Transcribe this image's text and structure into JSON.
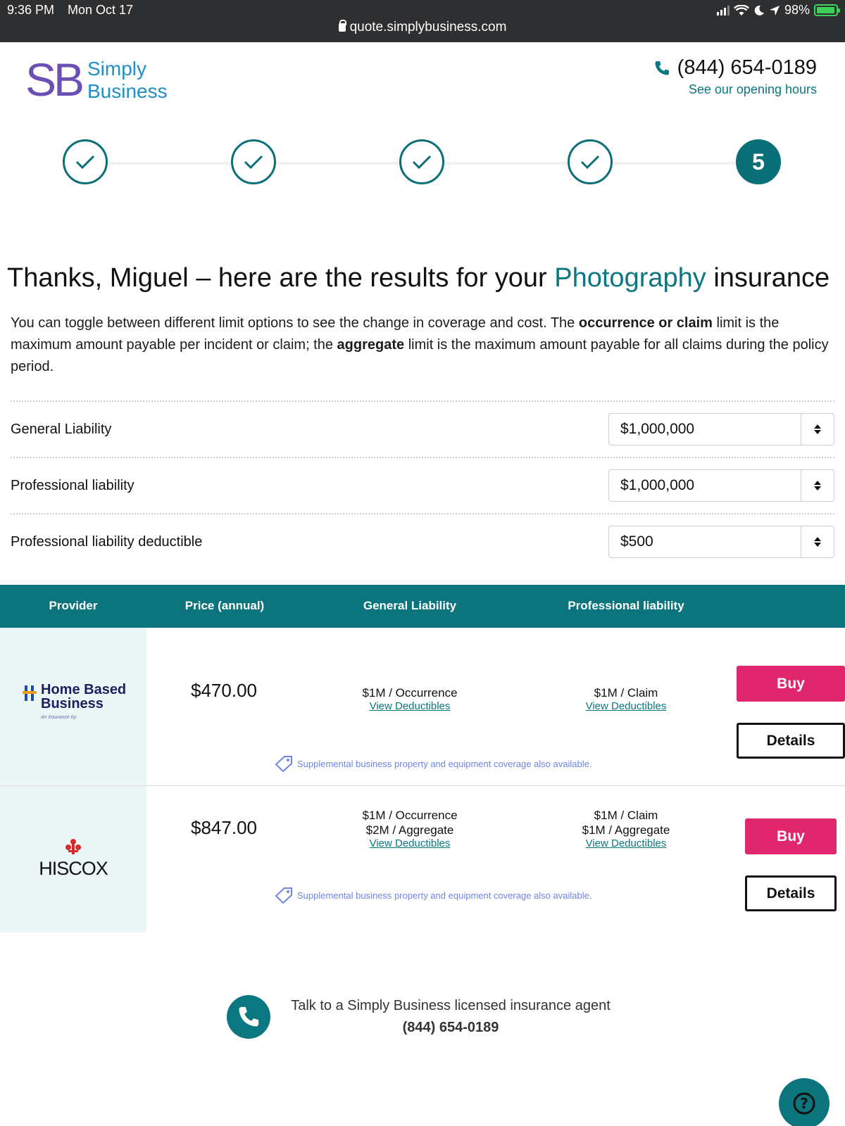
{
  "status_bar": {
    "time": "9:36 PM",
    "date": "Mon Oct 17",
    "battery": "98%",
    "battery_level": 0.98,
    "url": "quote.simplybusiness.com"
  },
  "header": {
    "logo_mark": "SB",
    "logo_line1": "Simply",
    "logo_line2": "Business",
    "phone": "(844) 654-0189",
    "opening_hours_link": "See our opening hours"
  },
  "progress": {
    "current_step": "5",
    "completed_steps": 4
  },
  "page": {
    "title_before": "Thanks, Miguel – here are the results for your ",
    "title_highlight": "Photography",
    "title_after": " insurance",
    "intro_1": "You can toggle between different limit options to see the change in coverage and cost. The ",
    "intro_bold_1": "occurrence or claim",
    "intro_2": " limit is the maximum amount payable per incident or claim; the ",
    "intro_bold_2": "aggregate",
    "intro_3": " limit is the maximum amount payable for all claims during the policy period."
  },
  "limits": [
    {
      "label": "General Liability",
      "value": "$1,000,000"
    },
    {
      "label": "Professional liability",
      "value": "$1,000,000"
    },
    {
      "label": "Professional liability deductible",
      "value": "$500"
    }
  ],
  "table": {
    "headers": [
      "Provider",
      "Price (annual)",
      "General Liability",
      "Professional liability"
    ],
    "rows": [
      {
        "provider_line1": "Home Based",
        "provider_line2": "Business",
        "provider_sub": "An insurance by",
        "price": "$470.00",
        "gl_line1": "$1M / Occurrence",
        "gl_line2": "",
        "gl_link": "View Deductibles",
        "pl_line1": "$1M / Claim",
        "pl_line2": "",
        "pl_link": "View Deductibles",
        "supplemental": "Supplemental business property and equipment coverage also available.",
        "buy": "Buy",
        "details": "Details"
      },
      {
        "provider_line1": "HISCOX",
        "price": "$847.00",
        "gl_line1": "$1M / Occurrence",
        "gl_line2": "$2M / Aggregate",
        "gl_link": "View Deductibles",
        "pl_line1": "$1M / Claim",
        "pl_line2": "$1M / Aggregate",
        "pl_link": "View Deductibles",
        "supplemental": "Supplemental business property and equipment coverage also available.",
        "buy": "Buy",
        "details": "Details"
      }
    ]
  },
  "agent": {
    "text": "Talk to a Simply Business licensed insurance agent",
    "phone": "(844) 654-0189"
  },
  "colors": {
    "teal": "#0b747c",
    "buy_pink": "#e0266c",
    "logo_purple": "#6b4fb5",
    "logo_blue": "#1e8fc7"
  }
}
